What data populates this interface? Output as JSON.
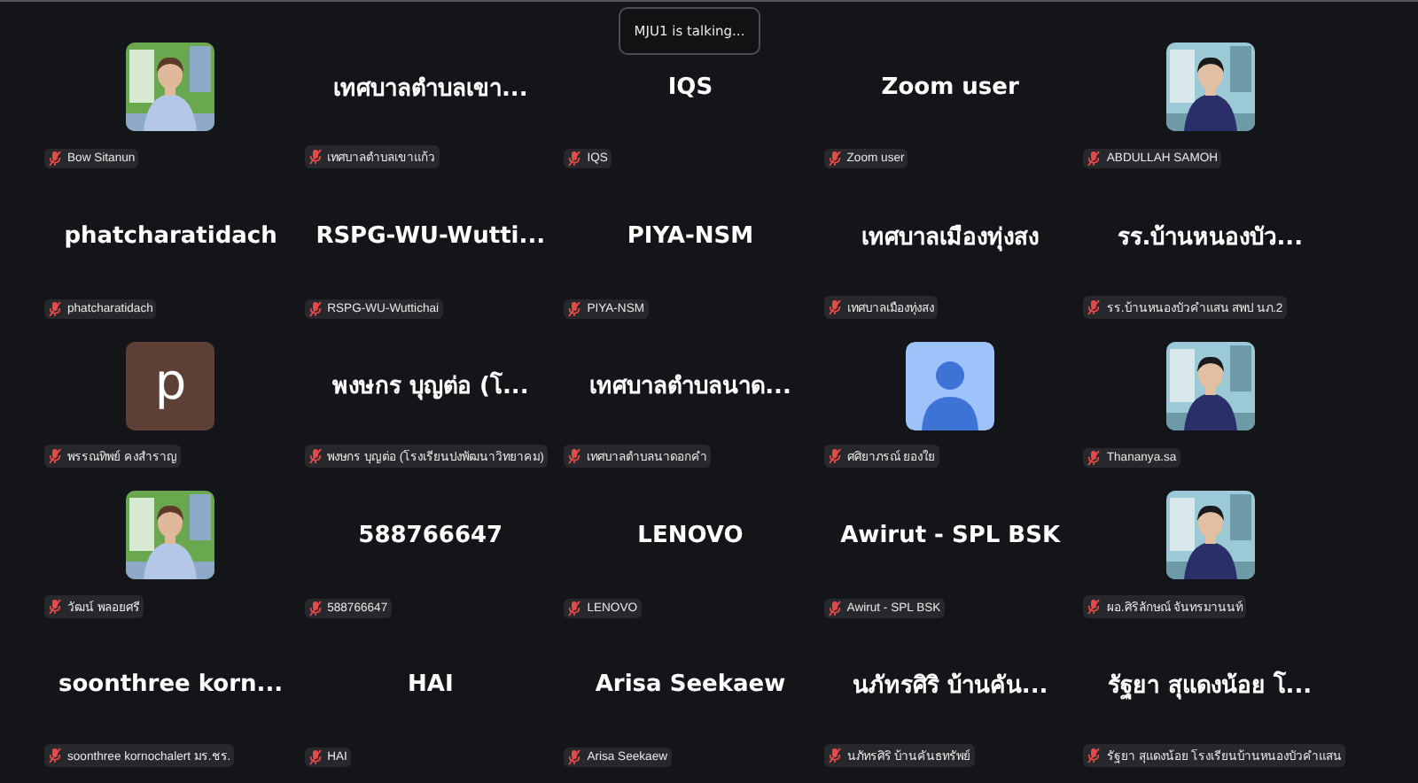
{
  "speaker_notice": "MJU1 is talking...",
  "tiles": [
    {
      "kind": "picture",
      "label": "Bow Sitanun",
      "muted": true
    },
    {
      "kind": "name",
      "display": "เทศบาลตำบลเขา...",
      "label": "เทศบาลตำบลเขาแก้ว",
      "muted": true
    },
    {
      "kind": "name",
      "display": "IQS",
      "label": "IQS",
      "muted": true
    },
    {
      "kind": "name",
      "display": "Zoom user",
      "label": "Zoom user",
      "muted": true
    },
    {
      "kind": "picture",
      "label": "ABDULLAH SAMOH",
      "muted": true
    },
    {
      "kind": "name",
      "display": "phatcharatidach",
      "label": "phatcharatidach",
      "muted": true
    },
    {
      "kind": "name",
      "display": "RSPG-WU-Wutti...",
      "label": "RSPG-WU-Wuttichai",
      "muted": true
    },
    {
      "kind": "name",
      "display": "PIYA-NSM",
      "label": "PIYA-NSM",
      "muted": true
    },
    {
      "kind": "name",
      "display": "เทศบาลเมืองทุ่งสง",
      "label": "เทศบาลเมืองทุ่งสง",
      "muted": true
    },
    {
      "kind": "name",
      "display": "รร.บ้านหนองบัว...",
      "label": "รร.บ้านหนองบัวคำแสน สพป นภ.2",
      "muted": true
    },
    {
      "kind": "letter",
      "display": "p",
      "label": "พรรณทิพย์ คงสำราญ",
      "muted": true
    },
    {
      "kind": "name",
      "display": "พงษกร  บุญต่อ (โ...",
      "label": "พงษกร  บุญต่อ (โรงเรียนปงพัฒนาวิทยาคม)",
      "muted": true
    },
    {
      "kind": "name",
      "display": "เทศบาลตำบลนาด...",
      "label": "เทศบาลตำบลนาดอกคำ",
      "muted": true
    },
    {
      "kind": "default",
      "label": "ศศิยาภรณ์ ยองใย",
      "muted": true
    },
    {
      "kind": "picture",
      "label": "Thananya.sa",
      "muted": true
    },
    {
      "kind": "picture",
      "label": "วัฒน์ พลอยศรี",
      "muted": true
    },
    {
      "kind": "name",
      "display": "588766647",
      "label": "588766647",
      "muted": true
    },
    {
      "kind": "name",
      "display": "LENOVO",
      "label": "LENOVO",
      "muted": true
    },
    {
      "kind": "name",
      "display": "Awirut - SPL BSK",
      "label": "Awirut - SPL BSK",
      "muted": true
    },
    {
      "kind": "picture",
      "label": "ผอ.ศิริลักษณ์ จันทรมานนท์",
      "muted": true
    },
    {
      "kind": "name",
      "display": "soonthree  korn...",
      "label": "soonthree kornochalert มร.ชร.",
      "muted": true
    },
    {
      "kind": "name",
      "display": "HAI",
      "label": "HAI",
      "muted": true
    },
    {
      "kind": "name",
      "display": "Arisa Seekaew",
      "label": "Arisa Seekaew",
      "muted": true
    },
    {
      "kind": "name",
      "display": "นภัทรศิริ บ้านคัน...",
      "label": "นภัทรศิริ บ้านคันธทรัพย์",
      "muted": true
    },
    {
      "kind": "name",
      "display": "รัฐยา สุแดงน้อย โ...",
      "label": "รัฐยา สุแดงน้อย โรงเรียนบ้านหนองบัวคำแสน",
      "muted": true
    }
  ]
}
